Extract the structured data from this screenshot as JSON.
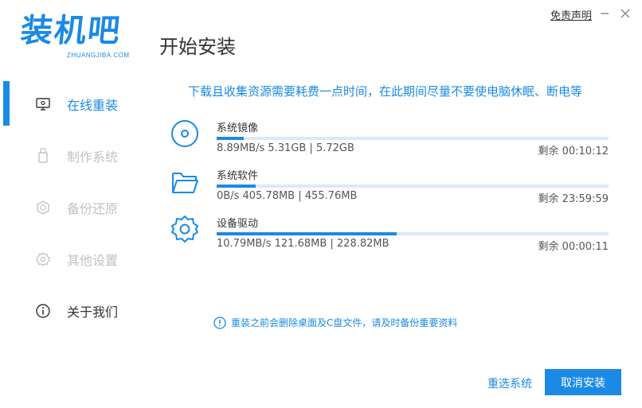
{
  "header": {
    "logo_text": "装机吧",
    "logo_subtext": "ZHUANGJIBA.COM",
    "title": "开始安装",
    "disclaimer_label": "免责声明"
  },
  "sidebar": {
    "items": [
      {
        "label": "在线重装",
        "icon": "monitor-icon",
        "state": "active"
      },
      {
        "label": "制作系统",
        "icon": "usb-icon",
        "state": "disabled"
      },
      {
        "label": "备份还原",
        "icon": "backup-icon",
        "state": "disabled"
      },
      {
        "label": "其他设置",
        "icon": "gear-icon",
        "state": "disabled"
      },
      {
        "label": "关于我们",
        "icon": "info-icon",
        "state": "normal"
      }
    ]
  },
  "main": {
    "notice": "下载且收集资源需要耗费一点时间，在此期间尽量不要使电脑休眠、断电等",
    "tasks": [
      {
        "name": "系统镜像",
        "icon": "disc-icon",
        "stats": "8.89MB/s 5.31GB | 5.72GB",
        "remaining": "剩余 00:10:12",
        "progress": 0.07
      },
      {
        "name": "系统软件",
        "icon": "folder-icon",
        "stats": "0B/s 405.78MB | 455.76MB",
        "remaining": "剩余 23:59:59",
        "progress": 0.1
      },
      {
        "name": "设备驱动",
        "icon": "gear-icon",
        "stats": "10.79MB/s 121.68MB | 228.82MB",
        "remaining": "剩余 00:00:11",
        "progress": 0.46
      }
    ],
    "warning": "重装之前会删除桌面及C盘文件，请及时备份重要资料"
  },
  "footer": {
    "reselect_label": "重选系统",
    "cancel_label": "取消安装"
  },
  "colors": {
    "accent": "#1a8ae5",
    "track": "#dbe9f7",
    "disabled": "#c2c2c2"
  }
}
